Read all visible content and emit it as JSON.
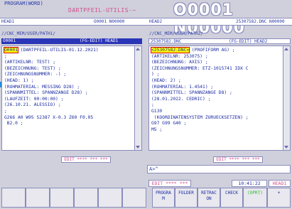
{
  "header": {
    "prog_label": "PROGRAM(WORD)",
    "prog_title": "DARTPFEIL-UTILIS-~",
    "big_number": "O0001 N00000"
  },
  "channel": {
    "left_head": "HEAD1",
    "left_prog": "O0001 N00000",
    "right_head": "HEAD2",
    "right_prog": "25307582.DNC N00000"
  },
  "left": {
    "path": "//CNC_MEM/USER/PATH1/",
    "file_name": "O0001",
    "file_mode": "(FG-EDIT) HEAD1",
    "lines": [
      "O0001 (DARTPFEIL-UTILIS-01.12.2021)",
      ";",
      "(ARTIKELNR: TEST) ;",
      "(BEZEICHNUNG: TEST) ;",
      "(ZEICHNUNGSNUMMER: -) ;",
      "(HEAD: 1) ;",
      "(ROHMATERIAL: MESSING D28) ;",
      "(SPANNMITTEL: SPANNZANGE D28) ;",
      "(LAUFZEIT: 00:00:00) ;",
      "(26.10.21. ALESSIO) ;",
      ";",
      "G266 A0 W95 S2387 X-0.3 Z60 F0.05",
      " B2.0 ;"
    ],
    "edit_label": "EDIT **** *** ***"
  },
  "right": {
    "path": "//CNC_MEM/USER/PATH2/",
    "file_name": "25307582.DNC",
    "file_mode": "(FG-EDIT) HEAD2",
    "lines": [
      "<25307582.DNC> (PROFIFORM AG) ;",
      "(ARTIKELNR: 253075) ;",
      "(BEZEICHNUNG: AXIS) ;",
      "(ZEICHNUNGSNUMMER: ETZ-1015741 IDX C",
      ") ;",
      "(HEAD: 2) ;",
      "(ROHMATERIAL: 1.4541) ;",
      "(SPANNMITTEL: SPANNZANGE D8) ;",
      "(28.01.2022. CEDRIC) ;",
      ";",
      "G130",
      " (KOORDINATENSYSTEM ZURUECKSETZEN) ;",
      "G97 G99 G40 ;",
      "M5 ;"
    ],
    "edit_label": "EDIT **** *** ***"
  },
  "input_line": "A>^",
  "status": {
    "mode": "EDIT **** *** ***",
    "time": "10:41:22",
    "head": "HEAD1"
  },
  "softkeys": [
    "",
    "",
    "",
    "",
    "",
    "",
    "PROGRA M",
    "FOLDER",
    "RETRAC ON",
    "CHECK",
    "(OPRT)",
    "+"
  ],
  "colors": {
    "active_bar": "#2a35b8",
    "highlight": "#ffff00",
    "accent_pink": "#d44a8c",
    "text_blue": "#1a2aa0",
    "oprt_green": "#2ab82a"
  }
}
